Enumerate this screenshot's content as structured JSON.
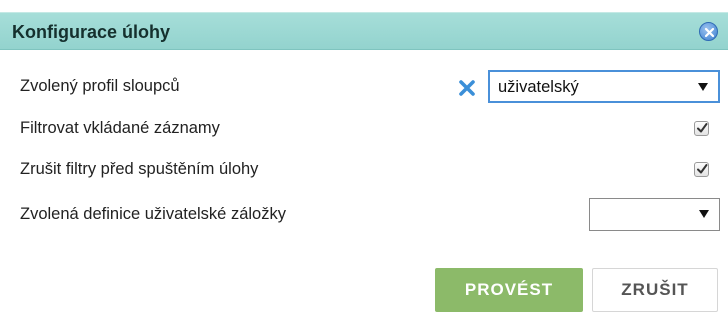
{
  "dialog": {
    "title": "Konfigurace úlohy",
    "close_icon": "close-circle-icon"
  },
  "rows": {
    "column_profile": {
      "label": "Zvolený profil sloupců",
      "clear_icon": "clear-x-icon",
      "selected": "uživatelský"
    },
    "filter_inserted": {
      "label": "Filtrovat vkládané záznamy",
      "checked": true
    },
    "clear_filters": {
      "label": "Zrušit filtry před spuštěním úlohy",
      "checked": true
    },
    "tab_definition": {
      "label": "Zvolená definice uživatelské záložky",
      "selected": ""
    }
  },
  "buttons": {
    "primary_label": "PROVÉST",
    "secondary_label": "ZRUŠIT"
  },
  "colors": {
    "titlebar": "#9fdad5",
    "primary_button": "#8cba69",
    "focus_border": "#4a90d9",
    "clear_x": "#3b8fd8"
  }
}
